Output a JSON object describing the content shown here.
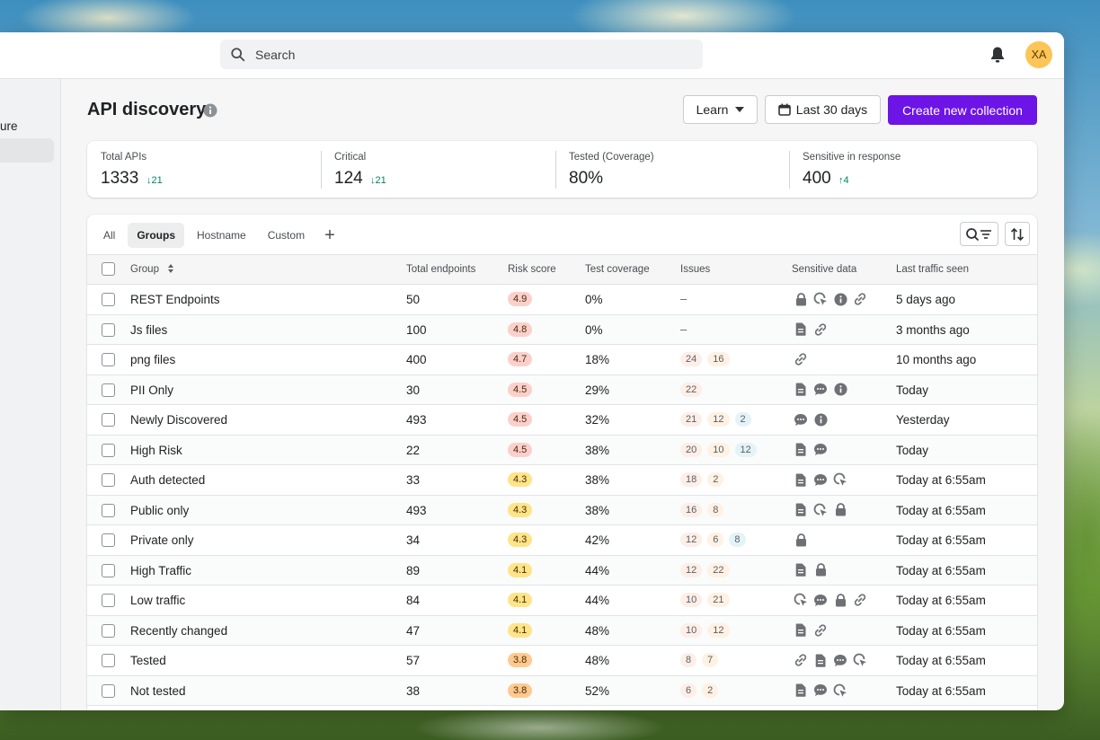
{
  "header": {
    "search_placeholder": "Search",
    "avatar_initials": "XA"
  },
  "sidebar": {
    "partial_label": "ure"
  },
  "page": {
    "title": "API discovery",
    "learn_label": "Learn",
    "date_label": "Last 30 days",
    "create_label": "Create new collection"
  },
  "stats": [
    {
      "label": "Total APIs",
      "value": "1333",
      "delta": "21",
      "dir": "down"
    },
    {
      "label": "Critical",
      "value": "124",
      "delta": "21",
      "dir": "down"
    },
    {
      "label": "Tested (Coverage)",
      "value": "80%",
      "delta": "",
      "dir": ""
    },
    {
      "label": "Sensitive in response",
      "value": "400",
      "delta": "4",
      "dir": "up"
    }
  ],
  "tabs": [
    "All",
    "Groups",
    "Hostname",
    "Custom"
  ],
  "active_tab": "Groups",
  "columns": {
    "group": "Group",
    "total": "Total endpoints",
    "risk": "Risk score",
    "coverage": "Test coverage",
    "issues": "Issues",
    "sensitive": "Sensitive data",
    "traffic": "Last traffic seen"
  },
  "colors": {
    "primary": "#6d14e6",
    "risk_red": "#fbd0cc",
    "risk_yellow": "#ffe488",
    "risk_orange": "#ffc98f",
    "positive": "#007f5f"
  },
  "rows": [
    {
      "group": "REST Endpoints",
      "total": "50",
      "risk": "4.9",
      "coverage": "0%",
      "issues": [],
      "sensitive": [
        "lock-icon",
        "cursor-icon",
        "info-icon",
        "link-icon"
      ],
      "traffic": "5 days ago"
    },
    {
      "group": "Js files",
      "total": "100",
      "risk": "4.8",
      "coverage": "0%",
      "issues": [],
      "sensitive": [
        "document-icon",
        "link-icon"
      ],
      "traffic": "3 months ago"
    },
    {
      "group": "png files",
      "total": "400",
      "risk": "4.7",
      "coverage": "18%",
      "issues": [
        "24",
        "16"
      ],
      "sensitive": [
        "link-icon"
      ],
      "traffic": "10 months ago"
    },
    {
      "group": "PII Only",
      "total": "30",
      "risk": "4.5",
      "coverage": "29%",
      "issues": [
        "22"
      ],
      "sensitive": [
        "document-icon",
        "chat-icon",
        "info-icon"
      ],
      "traffic": "Today"
    },
    {
      "group": "Newly Discovered",
      "total": "493",
      "risk": "4.5",
      "coverage": "32%",
      "issues": [
        "21",
        "12",
        "2"
      ],
      "sensitive": [
        "chat-icon",
        "info-icon"
      ],
      "traffic": "Yesterday"
    },
    {
      "group": "High Risk",
      "total": "22",
      "risk": "4.5",
      "coverage": "38%",
      "issues": [
        "20",
        "10",
        "12"
      ],
      "sensitive": [
        "document-icon",
        "chat-icon"
      ],
      "traffic": "Today"
    },
    {
      "group": "Auth detected",
      "total": "33",
      "risk": "4.3",
      "coverage": "38%",
      "issues": [
        "18",
        "2"
      ],
      "sensitive": [
        "document-icon",
        "chat-icon",
        "cursor-icon"
      ],
      "traffic": "Today at 6:55am"
    },
    {
      "group": "Public only",
      "total": "493",
      "risk": "4.3",
      "coverage": "38%",
      "issues": [
        "16",
        "8"
      ],
      "sensitive": [
        "document-icon",
        "cursor-icon",
        "lock-icon"
      ],
      "traffic": "Today at 6:55am"
    },
    {
      "group": "Private only",
      "total": "34",
      "risk": "4.3",
      "coverage": "42%",
      "issues": [
        "12",
        "6",
        "8"
      ],
      "sensitive": [
        "lock-icon"
      ],
      "traffic": "Today at 6:55am"
    },
    {
      "group": "High Traffic",
      "total": "89",
      "risk": "4.1",
      "coverage": "44%",
      "issues": [
        "12",
        "22"
      ],
      "sensitive": [
        "document-icon",
        "lock-icon"
      ],
      "traffic": "Today at 6:55am"
    },
    {
      "group": "Low traffic",
      "total": "84",
      "risk": "4.1",
      "coverage": "44%",
      "issues": [
        "10",
        "21"
      ],
      "sensitive": [
        "cursor-icon",
        "chat-icon",
        "lock-icon",
        "link-icon"
      ],
      "traffic": "Today at 6:55am"
    },
    {
      "group": "Recently changed",
      "total": "47",
      "risk": "4.1",
      "coverage": "48%",
      "issues": [
        "10",
        "12"
      ],
      "sensitive": [
        "document-icon",
        "link-icon"
      ],
      "traffic": "Today at 6:55am"
    },
    {
      "group": "Tested",
      "total": "57",
      "risk": "3.8",
      "coverage": "48%",
      "issues": [
        "8",
        "7"
      ],
      "sensitive": [
        "link-icon",
        "document-icon",
        "chat-icon",
        "cursor-icon"
      ],
      "traffic": "Today at 6:55am"
    },
    {
      "group": "Not tested",
      "total": "38",
      "risk": "3.8",
      "coverage": "52%",
      "issues": [
        "6",
        "2"
      ],
      "sensitive": [
        "document-icon",
        "chat-icon",
        "cursor-icon"
      ],
      "traffic": "Today at 6:55am"
    }
  ]
}
